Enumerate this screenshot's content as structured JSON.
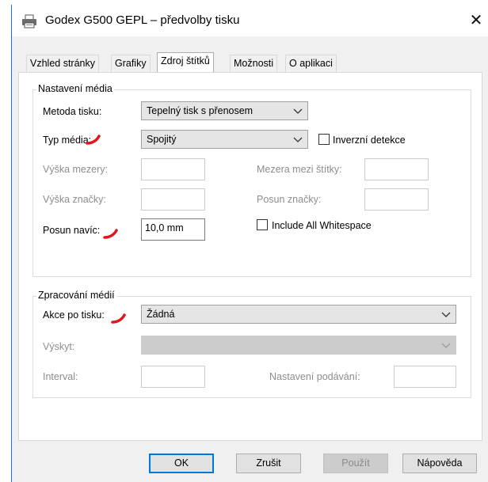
{
  "window": {
    "title": "Godex G500 GEPL – předvolby tisku",
    "close_glyph": "✕"
  },
  "tabs": [
    {
      "label": "Vzhled stránky"
    },
    {
      "label": "Grafiky"
    },
    {
      "label": "Zdroj štítků",
      "active": true
    },
    {
      "label": "Možnosti"
    },
    {
      "label": "O aplikaci"
    }
  ],
  "media_settings": {
    "group_title": "Nastavení média",
    "print_method_label": "Metoda tisku:",
    "print_method_value": "Tepelný tisk s přenosem",
    "media_type_label": "Typ média:",
    "media_type_value": "Spojitý",
    "inverse_detection_label": "Inverzní detekce",
    "gap_height_label": "Výška mezery:",
    "gap_height_value": "",
    "mark_height_label": "Výška značky:",
    "mark_height_value": "",
    "label_gap_label": "Mezera mezi štítky:",
    "label_gap_value": "",
    "mark_offset_label": "Posun značky:",
    "mark_offset_value": "",
    "extra_offset_label": "Posun navíc:",
    "extra_offset_value": "10,0 mm",
    "include_whitespace_label": "Include All Whitespace"
  },
  "media_handling": {
    "group_title": "Zpracování médií",
    "post_print_action_label": "Akce po tisku:",
    "post_print_action_value": "Žádná",
    "occurrence_label": "Výskyt:",
    "occurrence_value": "",
    "interval_label": "Interval:",
    "interval_value": "",
    "feed_setting_label": "Nastavení podávání:",
    "feed_setting_value": ""
  },
  "buttons": {
    "ok": "OK",
    "cancel": "Zrušit",
    "apply": "Použít",
    "help": "Nápověda"
  },
  "colors": {
    "annotation": "#e8141b",
    "focus": "#0078d7"
  }
}
